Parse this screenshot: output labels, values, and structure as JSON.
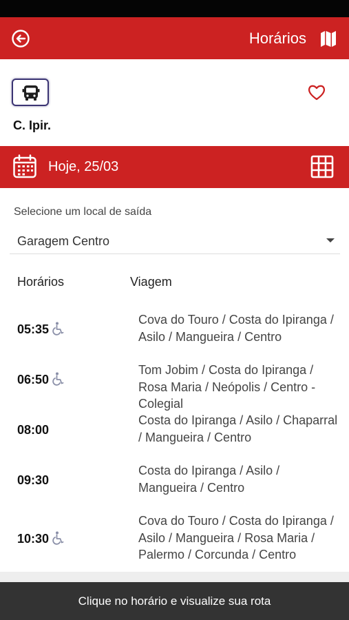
{
  "app_bar": {
    "title": "Horários",
    "back_icon": "back-circle-arrow-icon",
    "map_icon": "map-icon"
  },
  "line": {
    "name": "C. Ipir.",
    "icon": "bus-icon",
    "favorite_icon": "heart-outline-icon"
  },
  "date_bar": {
    "date_label": "Hoje, 25/03",
    "calendar_icon": "calendar-icon",
    "grid_icon": "grid-icon"
  },
  "origin": {
    "label": "Selecione um local de saída",
    "selected": "Garagem Centro"
  },
  "table": {
    "time_header": "Horários",
    "trip_header": "Viagem",
    "rows": [
      {
        "time": "05:35",
        "accessible": true,
        "route": "Cova do Touro / Costa do Ipiranga / Asilo / Mangueira / Centro"
      },
      {
        "time": "06:50",
        "accessible": true,
        "route": "Tom Jobim / Costa do Ipiranga / Rosa Maria / Neópolis / Centro - Colegial"
      },
      {
        "time": "08:00",
        "accessible": false,
        "route": "Costa do Ipiranga / Asilo / Chaparral / Mangueira / Centro"
      },
      {
        "time": "09:30",
        "accessible": false,
        "route": "Costa do Ipiranga / Asilo / Mangueira / Centro"
      },
      {
        "time": "10:30",
        "accessible": true,
        "route": "Cova do Touro / Costa do Ipiranga / Asilo / Mangueira / Rosa Maria / Palermo / Corcunda / Centro"
      }
    ]
  },
  "footer": {
    "hint": "Clique no horário e visualize sua rota"
  },
  "colors": {
    "primary_red": "#cc2222",
    "footer_dark": "#333333",
    "accessible_icon": "#8a8fa8",
    "badge_border": "#3b3473"
  }
}
